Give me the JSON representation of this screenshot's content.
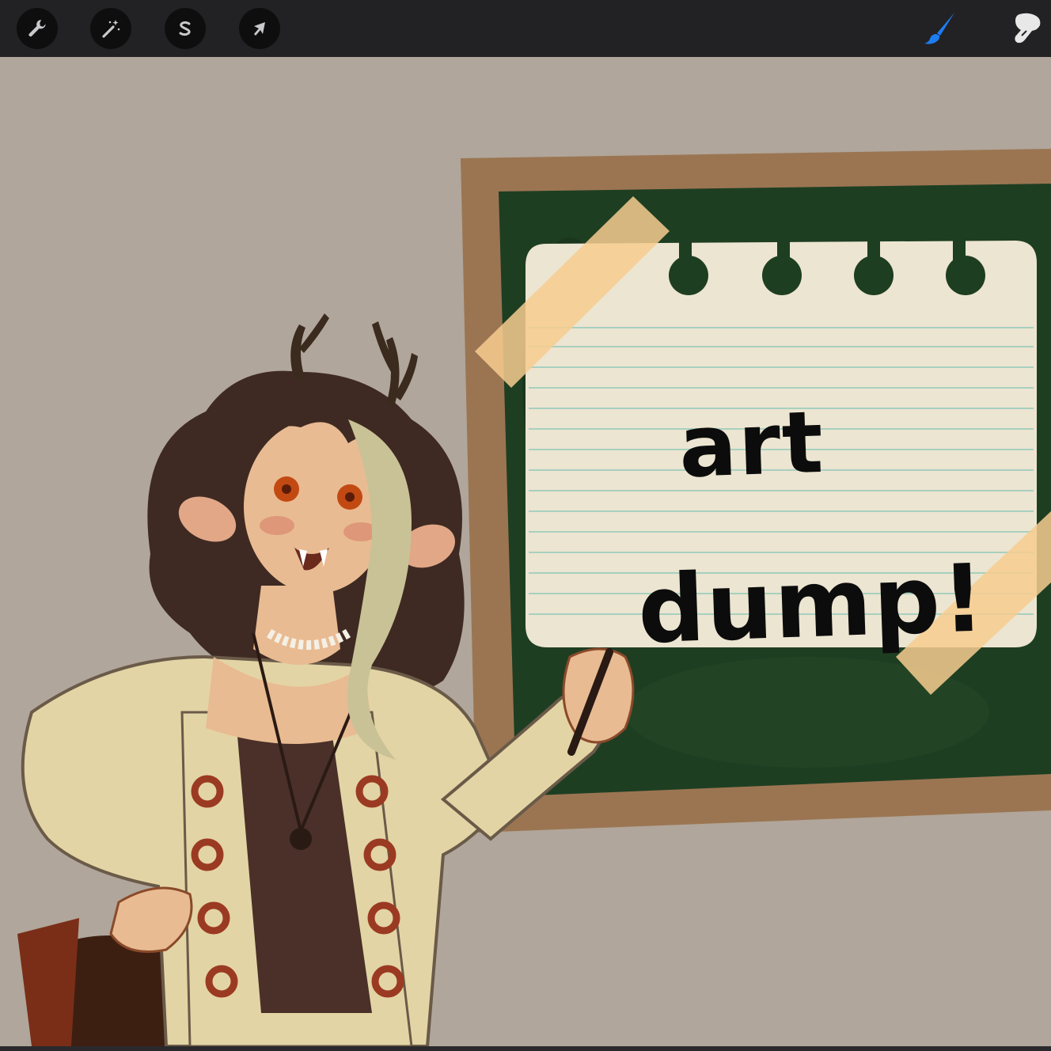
{
  "toolbar": {
    "left_tools": [
      {
        "name": "actions",
        "icon": "wrench-icon"
      },
      {
        "name": "adjustments",
        "icon": "magic-wand-icon"
      },
      {
        "name": "selection",
        "icon": "selection-s-icon"
      },
      {
        "name": "transform",
        "icon": "arrow-cursor-icon"
      }
    ],
    "right_tools": [
      {
        "name": "brush",
        "icon": "brush-icon",
        "active": true,
        "color": "#1e7cf2"
      },
      {
        "name": "smudge",
        "icon": "smudge-icon",
        "active": false,
        "color": "#e8e8e8"
      }
    ]
  },
  "canvas": {
    "background": "#b0a69b",
    "note": {
      "line1": "art",
      "line2": "dump!"
    }
  }
}
